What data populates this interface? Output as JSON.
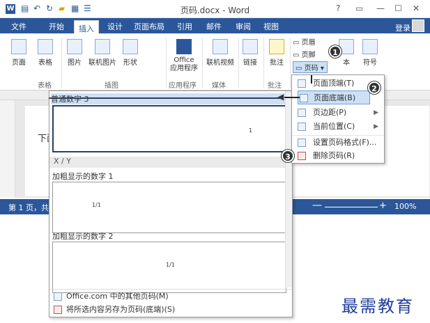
{
  "window": {
    "title": "页码.docx - Word",
    "help": "?",
    "controls": [
      "▭",
      "—",
      "☐",
      "✕"
    ]
  },
  "tabs": [
    "文件",
    "开始",
    "插入",
    "设计",
    "页面布局",
    "引用",
    "邮件",
    "审阅",
    "视图"
  ],
  "login": "登录",
  "ribbon": {
    "buttons": [
      {
        "label": "页面"
      },
      {
        "label": "表格"
      },
      {
        "label": "图片"
      },
      {
        "label": "联机图片"
      },
      {
        "label": "形状"
      },
      {
        "label": "Office\n应用程序"
      },
      {
        "label": "联机视频"
      },
      {
        "label": "链接"
      },
      {
        "label": "批注"
      },
      {
        "label": "页眉"
      },
      {
        "label": "页脚"
      },
      {
        "label": "页码"
      },
      {
        "label": "本"
      },
      {
        "label": "符号"
      }
    ],
    "groups": [
      "表格",
      "插图",
      "应用程序",
      "媒体",
      "批注"
    ]
  },
  "page_text": "下面",
  "status_text": "第 1 页，共",
  "zoom": "100%",
  "gallery": {
    "item1": "普通数字 3",
    "section": "X / Y",
    "item2": "加粗显示的数字 1",
    "item2_preview": "1/1",
    "item3": "加粗显示的数字 2",
    "item3_preview": "1/1",
    "footer1": "Office.com 中的其他页码(M)",
    "footer2": "将所选内容另存为页码(底端)(S)"
  },
  "menu": {
    "items": [
      {
        "label": "页面顶端(T)",
        "submenu": true
      },
      {
        "label": "页面底端(B)",
        "submenu": true
      },
      {
        "label": "页边距(P)",
        "submenu": true
      },
      {
        "label": "当前位置(C)",
        "submenu": true
      },
      {
        "label": "设置页码格式(F)..."
      },
      {
        "label": "删除页码(R)"
      }
    ]
  },
  "badges": [
    "1",
    "2",
    "3"
  ],
  "watermark": "最需教育"
}
